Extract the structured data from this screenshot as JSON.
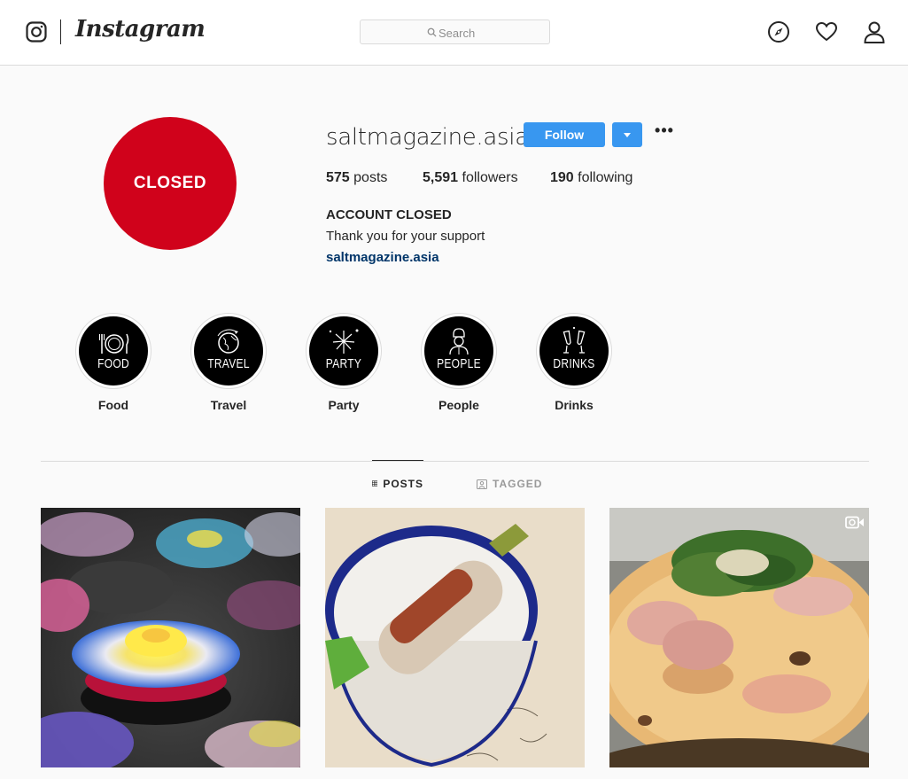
{
  "nav": {
    "logo_text": "Instagram",
    "search_placeholder": "Search",
    "icons": [
      "instagram-glyph-icon",
      "search-icon",
      "compass-icon",
      "heart-icon",
      "person-icon"
    ]
  },
  "profile": {
    "avatar_text": "CLOSED",
    "username": "saltmagazine.asia",
    "follow_label": "Follow",
    "more_label": "•••",
    "stats": {
      "posts_count": "575",
      "posts_label": "posts",
      "followers_count": "5,591",
      "followers_label": "followers",
      "following_count": "190",
      "following_label": "following"
    },
    "bio_name": "ACCOUNT CLOSED",
    "bio_text": "Thank you for your support",
    "bio_link": "saltmagazine.asia"
  },
  "highlights": [
    {
      "caption": "FOOD",
      "label": "Food",
      "icon": "plate-cutlery-icon"
    },
    {
      "caption": "TRAVEL",
      "label": "Travel",
      "icon": "globe-plane-icon"
    },
    {
      "caption": "PARTY",
      "label": "Party",
      "icon": "fireworks-icon"
    },
    {
      "caption": "PEOPLE",
      "label": "People",
      "icon": "chef-icon"
    },
    {
      "caption": "DRINKS",
      "label": "Drinks",
      "icon": "champagne-glasses-icon"
    }
  ],
  "tabs": {
    "posts": "POSTS",
    "tagged": "TAGGED"
  },
  "posts": [
    {
      "subject": "colorful flower-shaped dessert"
    },
    {
      "subject": "grilled corn in enamel bowl"
    },
    {
      "subject": "prosciutto arugula pizza",
      "badge": "video-camera-icon"
    }
  ],
  "colors": {
    "accent": "#3897f0",
    "avatar_bg": "#d0021b",
    "link": "#003569"
  }
}
